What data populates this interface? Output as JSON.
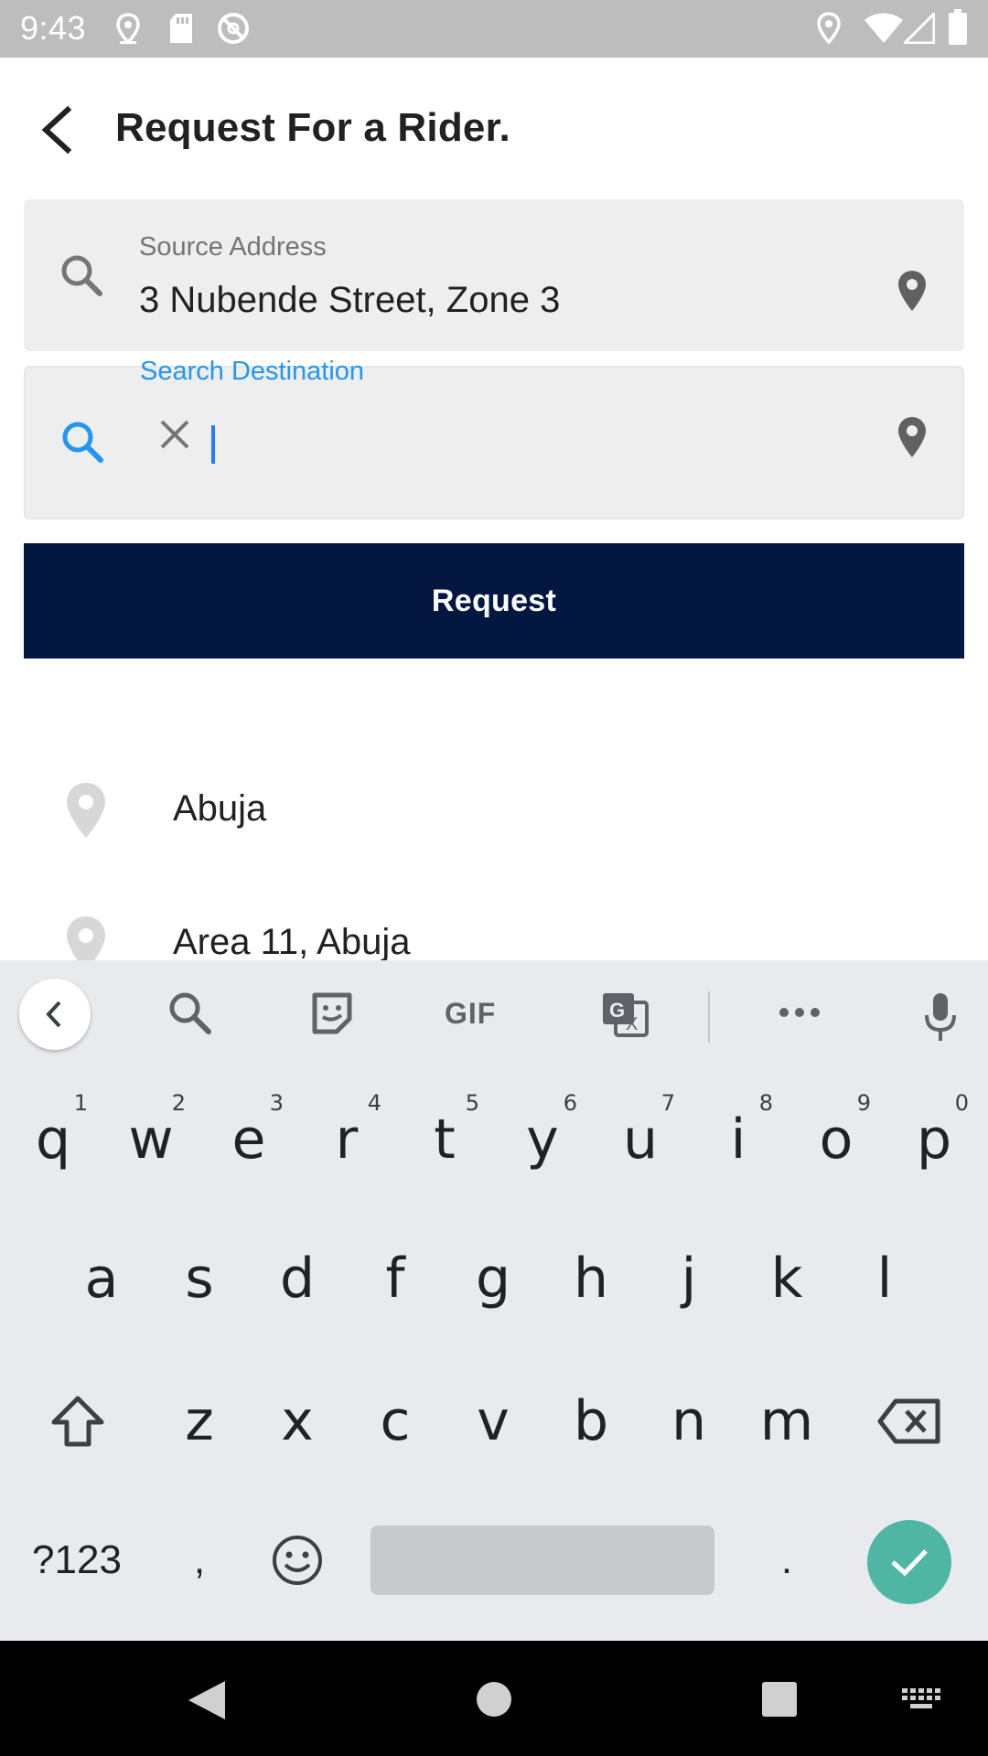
{
  "status_bar": {
    "time": "9:43"
  },
  "header": {
    "title": "Request For a Rider."
  },
  "source": {
    "label": "Source Address",
    "value": "3 Nubende Street, Zone 3"
  },
  "destination": {
    "label": "Search Destination",
    "value": "",
    "placeholder": ""
  },
  "request_button": {
    "label": "Request"
  },
  "suggestions": [
    {
      "text": "Abuja"
    },
    {
      "text": "Area 11, Abuja"
    }
  ],
  "keyboard": {
    "toolbar": {
      "gif_label": "GIF"
    },
    "row1": [
      {
        "key": "q",
        "hint": "1"
      },
      {
        "key": "w",
        "hint": "2"
      },
      {
        "key": "e",
        "hint": "3"
      },
      {
        "key": "r",
        "hint": "4"
      },
      {
        "key": "t",
        "hint": "5"
      },
      {
        "key": "y",
        "hint": "6"
      },
      {
        "key": "u",
        "hint": "7"
      },
      {
        "key": "i",
        "hint": "8"
      },
      {
        "key": "o",
        "hint": "9"
      },
      {
        "key": "p",
        "hint": "0"
      }
    ],
    "row2": [
      "a",
      "s",
      "d",
      "f",
      "g",
      "h",
      "j",
      "k",
      "l"
    ],
    "row3": [
      "z",
      "x",
      "c",
      "v",
      "b",
      "n",
      "m"
    ],
    "symbols_key": "?123",
    "comma_key": ",",
    "period_key": "."
  },
  "colors": {
    "primary_button": "#041741",
    "accent_blue": "#2196f3",
    "enter_key": "#4fb6a4"
  },
  "icons": {
    "back": "arrow-back-icon",
    "source_search": "search-icon",
    "pin": "location-pin-icon",
    "clear": "close-icon",
    "mic": "microphone-icon"
  }
}
